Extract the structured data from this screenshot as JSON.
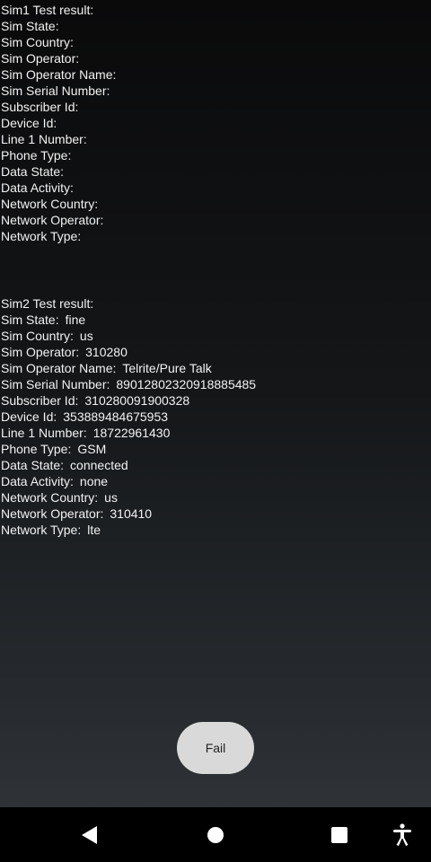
{
  "sim1": {
    "header": "Sim1 Test result:",
    "rows": [
      {
        "label": "Sim State:",
        "value": ""
      },
      {
        "label": "Sim Country:",
        "value": ""
      },
      {
        "label": "Sim Operator:",
        "value": ""
      },
      {
        "label": "Sim Operator Name:",
        "value": ""
      },
      {
        "label": "Sim Serial Number:",
        "value": ""
      },
      {
        "label": "Subscriber Id:",
        "value": ""
      },
      {
        "label": "Device Id:",
        "value": ""
      },
      {
        "label": "Line 1 Number:",
        "value": ""
      },
      {
        "label": "Phone Type:",
        "value": ""
      },
      {
        "label": "Data State:",
        "value": ""
      },
      {
        "label": "Data Activity:",
        "value": ""
      },
      {
        "label": "Network Country:",
        "value": ""
      },
      {
        "label": "Network Operator:",
        "value": ""
      },
      {
        "label": "Network Type:",
        "value": ""
      }
    ]
  },
  "sim2": {
    "header": "Sim2 Test result:",
    "rows": [
      {
        "label": "Sim State:",
        "value": "fine"
      },
      {
        "label": "Sim Country:",
        "value": "us"
      },
      {
        "label": "Sim Operator:",
        "value": "310280"
      },
      {
        "label": "Sim Operator Name:",
        "value": "Telrite/Pure Talk"
      },
      {
        "label": "Sim Serial Number:",
        "value": "89012802320918885485"
      },
      {
        "label": "Subscriber Id:",
        "value": "310280091900328"
      },
      {
        "label": "Device Id:",
        "value": "353889484675953"
      },
      {
        "label": "Line 1 Number:",
        "value": "18722961430"
      },
      {
        "label": "Phone Type:",
        "value": "GSM"
      },
      {
        "label": "Data State:",
        "value": "connected"
      },
      {
        "label": "Data Activity:",
        "value": "none"
      },
      {
        "label": "Network Country:",
        "value": "us"
      },
      {
        "label": "Network Operator:",
        "value": "310410"
      },
      {
        "label": "Network Type:",
        "value": "lte"
      }
    ]
  },
  "fail_button": {
    "label": "Fail"
  },
  "navbar": {
    "back_icon": "back-triangle-icon",
    "home_icon": "home-circle-icon",
    "recents_icon": "recents-square-icon",
    "accessibility_icon": "accessibility-person-icon"
  }
}
